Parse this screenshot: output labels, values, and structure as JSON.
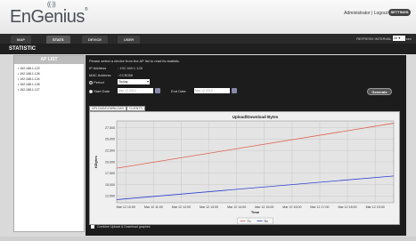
{
  "header": {
    "logo": "EnGenius",
    "admin_text": "Administrator | Logout",
    "settings_label": "SETTINGS"
  },
  "nav": {
    "tabs": [
      "MAP",
      "STATS",
      "DEVICE",
      "USER"
    ],
    "refresh_label": "REFRESH INTERVAL",
    "refresh_value": "30",
    "refresh_unit": "sec"
  },
  "page_title": "STATISTIC",
  "ap_list": {
    "title": "AP LIST",
    "items": [
      "192.168.1.122",
      "192.168.1.126",
      "192.168.1.124",
      "192.168.1.126",
      "192.168.1.127"
    ]
  },
  "panel": {
    "instructions": "Please select a device from the AP list to read its statistic.",
    "ip_label": "IP Address",
    "ip_value": ": 192.168.1.128",
    "mac_label": "MAC Address",
    "mac_value": ": ECB058",
    "period_label": "Period",
    "period_value": "Today",
    "start_label": "Start Date",
    "start_value": "Mar 12 2012",
    "end_label": "End Date",
    "end_value": "Mar 12 2012",
    "generate_label": "Generate",
    "subtabs": [
      "UPLOAD/DOWNLOAD",
      "CLIENTS"
    ],
    "combine_label": "Combine Upload & Download graphes"
  },
  "chart_data": {
    "type": "line",
    "title": "Upload/Download Bytes",
    "xlabel": "Time",
    "ylabel": "KBytes",
    "categories": [
      "Mar 12 10:00",
      "Mar 12 11:00",
      "Mar 12 12:00",
      "Mar 12 13:00",
      "Mar 12 14:00",
      "Mar 12 15:00",
      "Mar 12 16:00",
      "Mar 12 17:00",
      "Mar 12 18:00",
      "Mar 12 19:00"
    ],
    "y_ticks": [
      12500,
      15000,
      17500,
      20000,
      22500,
      25000,
      27500
    ],
    "ylim": [
      11000,
      29000
    ],
    "x_range": [
      9.67,
      19.67
    ],
    "series": [
      {
        "name": "Tx",
        "color": "#e06050",
        "x": [
          9.67,
          19.67
        ],
        "values": [
          18600,
          28500
        ]
      },
      {
        "name": "Rx",
        "color": "#3040d0",
        "x": [
          9.67,
          19.67
        ],
        "values": [
          11700,
          16900
        ]
      }
    ],
    "legend": "bottom-center",
    "grid": true
  }
}
